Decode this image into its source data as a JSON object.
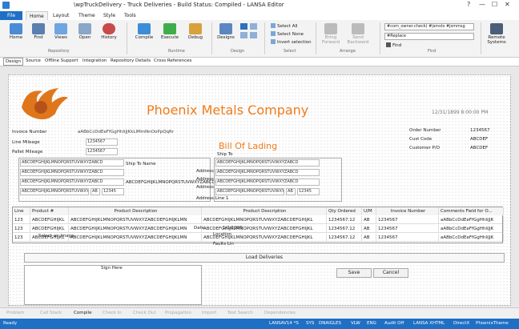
{
  "window": {
    "title": "\\wpTruckDelivery  -  Truck Deliveries  -  Build Status: Compiled  -  LANSA Editor",
    "controls": [
      "?",
      "—",
      "☐",
      "✕"
    ]
  },
  "ribbon_tabs": [
    "File",
    "Home",
    "Layout",
    "Theme",
    "Style",
    "Tools"
  ],
  "active_tab": "Home",
  "ribbon": {
    "repository": {
      "home": "Home",
      "find": "Find",
      "views": "Views",
      "open": "Open",
      "history": "History",
      "group": "Repository"
    },
    "runtime": {
      "compile": "Compile",
      "execute": "Execute",
      "debug": "Debug",
      "group": "Runtime"
    },
    "design": {
      "designs": "Designs",
      "group": "Design"
    },
    "select": {
      "select_all": "Select All",
      "select_none": "Select None",
      "invert": "Invert selection",
      "group": "Select"
    },
    "arrange": {
      "bring_forward": "Bring\nForward",
      "send_backward": "Send\nBackward",
      "group": "Arrange"
    },
    "find": {
      "combo1": "#com_owner.check( #jsmsts #jsmmsg",
      "combo2": "#Replace",
      "find_btn": "Find",
      "group": "Find"
    },
    "remote": {
      "label": "Remote\nSystems"
    }
  },
  "sub_tabs": [
    "Design",
    "Source",
    "Offline Support",
    "Integration",
    "Repository Details",
    "Cross References"
  ],
  "form": {
    "company": "Phoenix Metals Company",
    "datetime": "12/31/1899 8:00:00 PM",
    "title": "Bill Of Lading",
    "labels_left": {
      "invoice_number": "Invoice Number",
      "invoice_value": "aABbCcDdEeFfGgHhIiJjKkLlMmNnOoPpQqRr",
      "line_mileage": "Line Mileage",
      "mileage_value": "1234567",
      "pallet_mileage": "Pallet Mileage",
      "pallet_value": "1234567"
    },
    "labels_right": {
      "order_number": "Order Number",
      "order_value": "1234567",
      "cust_code": "Cust Code",
      "cust_value": "ABCDEF",
      "customer_po": "Customer P/O",
      "po_value": "ABCDEF"
    },
    "ship_to_name": "Ship To Name",
    "ship_to": "Ship To",
    "address": "Address",
    "address_line": "Address Line 1",
    "placeholder_text": "ABCDEFGHIJKLMNOPQRSTUVWXYZABCD",
    "placeholder_long": "ABCDEFGHIJKLMNOPQRSTUVWXYZABCDEFGHIJKLMN",
    "ab_value": "AB",
    "num_value": "12345",
    "grid": {
      "headers": [
        "Line",
        "Product #",
        "Product Description",
        "Product Description",
        "Qty Ordered",
        "U/M",
        "Invoice Number",
        "Comments Field for O..."
      ],
      "rows": [
        [
          "123",
          "ABCDEFGHIJKL",
          "ABCDEFGHIJKLMNOPQRSTUVWXYZABCDEFGHIJKLMN",
          "ABCDEFGHIJKLMNOPQRSTUVWXYZABCDEFGHIJKL",
          "1234567.12",
          "AB",
          "1234567",
          "aABbCcDdEeFfGgHhIiJjK"
        ],
        [
          "123",
          "ABCDEFGHIJKL",
          "ABCDEFGHIJKLMNOPQRSTUVWXYZABCDEFGHIJKLMN",
          "ABCDEFGHIJKLMNOPQRSTUVWXYZABCDEFGHIJKL",
          "1234567.12",
          "AB",
          "1234567",
          "aABbCcDdEeFfGgHhIiJjK"
        ],
        [
          "123",
          "ABCDEFGHIJKL",
          "ABCDEFGHIJKLMNOPQRSTUVWXYZABCDEFGHIJKLMN",
          "ABCDEFGHIJKLMNOPQRSTUVWXYZABCDEFGHIJKL",
          "1234567.12",
          "AB",
          "1234567",
          "aABbCcDdEeFfGgHhIiJjK"
        ]
      ]
    },
    "select_image": "Select an Image",
    "date_label": "Date",
    "date_value": "1/1/1900",
    "location_label": "Location",
    "faults_label": "Faults Lin",
    "load_deliveries": "Load Deliveries",
    "sign_here": "Sign Here",
    "save": "Save",
    "cancel": "Cancel"
  },
  "bottom_tabs": [
    "Problem",
    "Call Stack",
    "Compile",
    "Check In",
    "Check Out",
    "Propagation",
    "Import",
    "Text Search",
    "Dependencies"
  ],
  "active_bottom_tab": "Compile",
  "status": {
    "left": "Ready",
    "items": [
      "LANSAV14 *S",
      "SYS",
      "DNAIGLES",
      "VLW",
      "ENG",
      "Audit Off",
      "LANSA XHTML",
      "DirectX",
      "PhoenixTheme"
    ]
  },
  "colors": {
    "accent": "#1f6fc5",
    "brand_orange": "#f07c1a"
  }
}
